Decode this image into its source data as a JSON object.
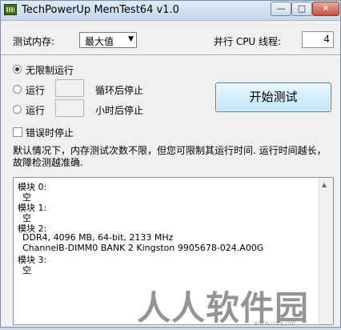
{
  "window": {
    "title": "TechPowerUp MemTest64 v1.0",
    "min_glyph": "—",
    "max_glyph": "□",
    "close_glyph": "✕"
  },
  "settings": {
    "memory_label": "测试内存:",
    "memory_value": "最大值",
    "threads_label": "并行 CPU 线程:",
    "threads_value": "4"
  },
  "mode": {
    "unlimited_label": "无限制运行",
    "run_label_1": "运行",
    "loops_suffix": "循环后停止",
    "run_label_2": "运行",
    "hours_suffix": "小时后停止",
    "stop_on_error_label": "错误时停止"
  },
  "start_button": "开始测试",
  "description": "默认情况下，内存测试次数不限，但您可限制其运行时间. 运行时间越长，故障检测越准确.",
  "output": [
    "模块 0:",
    "空",
    "模块 1:",
    "空",
    "模块 2:",
    "DDR4, 4096 MB, 64-bit, 2133 MHz",
    "ChannelB-DIMM0 BANK 2 Kingston 9905678-024.A00G",
    "模块 3:",
    "空"
  ],
  "watermark": "人人软件园",
  "watermark_sub": "www.rrxx.net"
}
